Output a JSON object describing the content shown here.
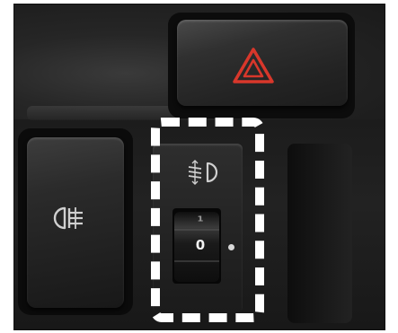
{
  "photo": {
    "subject": "",
    "highlight_color": "#ffffff",
    "hazard_symbol_color": "#d8372b"
  },
  "controls": {
    "hazard_button": {
      "icon": "hazard-triangle-icon"
    },
    "fog_light_button": {
      "icon": "rear-fog-light-icon"
    },
    "headlight_leveling": {
      "icon": "headlight-leveling-icon",
      "wheel_upper_label": "1",
      "wheel_current_label": "0"
    }
  }
}
